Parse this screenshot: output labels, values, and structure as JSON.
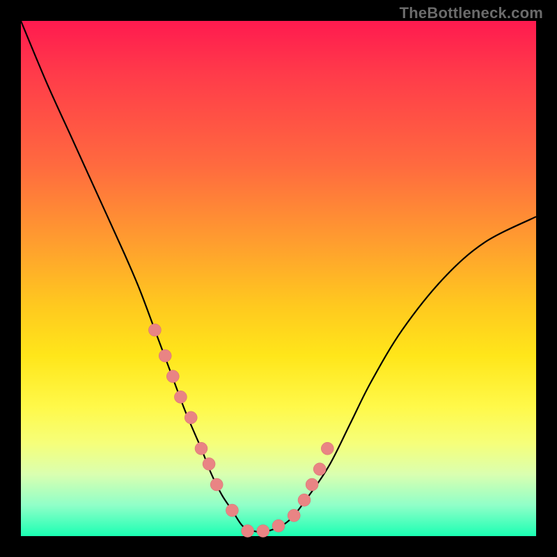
{
  "watermark": "TheBottleneck.com",
  "chart_data": {
    "type": "line",
    "title": "",
    "xlabel": "",
    "ylabel": "",
    "xlim": [
      0,
      100
    ],
    "ylim": [
      0,
      100
    ],
    "series": [
      {
        "name": "bottleneck-curve",
        "x": [
          0,
          5,
          10,
          15,
          20,
          23,
          26,
          29,
          32,
          35,
          37,
          39,
          41,
          43,
          45,
          48,
          52,
          56,
          60,
          64,
          68,
          74,
          82,
          90,
          100
        ],
        "values": [
          100,
          88,
          77,
          66,
          55,
          48,
          40,
          32,
          24,
          17,
          12,
          8,
          5,
          2,
          1,
          1,
          3,
          8,
          14,
          22,
          30,
          40,
          50,
          57,
          62
        ]
      }
    ],
    "markers": {
      "name": "highlight-beads",
      "x": [
        26,
        28,
        29.5,
        31,
        33,
        35,
        36.5,
        38,
        41,
        44,
        47,
        50,
        53,
        55,
        56.5,
        58,
        59.5
      ],
      "values": [
        40,
        35,
        31,
        27,
        23,
        17,
        14,
        10,
        5,
        1,
        1,
        2,
        4,
        7,
        10,
        13,
        17
      ]
    },
    "background_gradient": {
      "top": "#ff1a4f",
      "bottom": "#1affb3"
    }
  }
}
